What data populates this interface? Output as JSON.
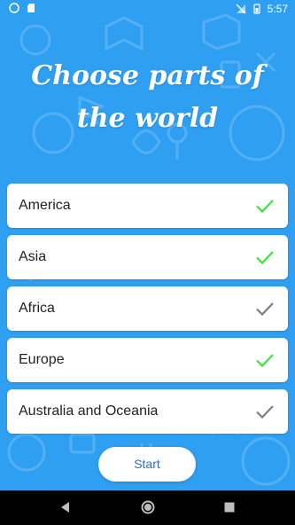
{
  "status_bar": {
    "time": "5:57",
    "left_icons": [
      "circle-status-icon",
      "sd-card-icon"
    ],
    "right_icons": [
      "no-signal-icon",
      "battery-icon"
    ]
  },
  "title": "Choose parts of the world",
  "regions": [
    {
      "label": "America",
      "selected": true
    },
    {
      "label": "Asia",
      "selected": true
    },
    {
      "label": "Africa",
      "selected": false
    },
    {
      "label": "Europe",
      "selected": true
    },
    {
      "label": "Australia and Oceania",
      "selected": false
    }
  ],
  "start_label": "Start",
  "colors": {
    "background": "#2f9ff2",
    "check_selected": "#3ee23e",
    "check_unselected": "#7f7f7f",
    "button_text": "#2b6fbf"
  },
  "nav": [
    "back-icon",
    "home-icon",
    "recents-icon"
  ]
}
